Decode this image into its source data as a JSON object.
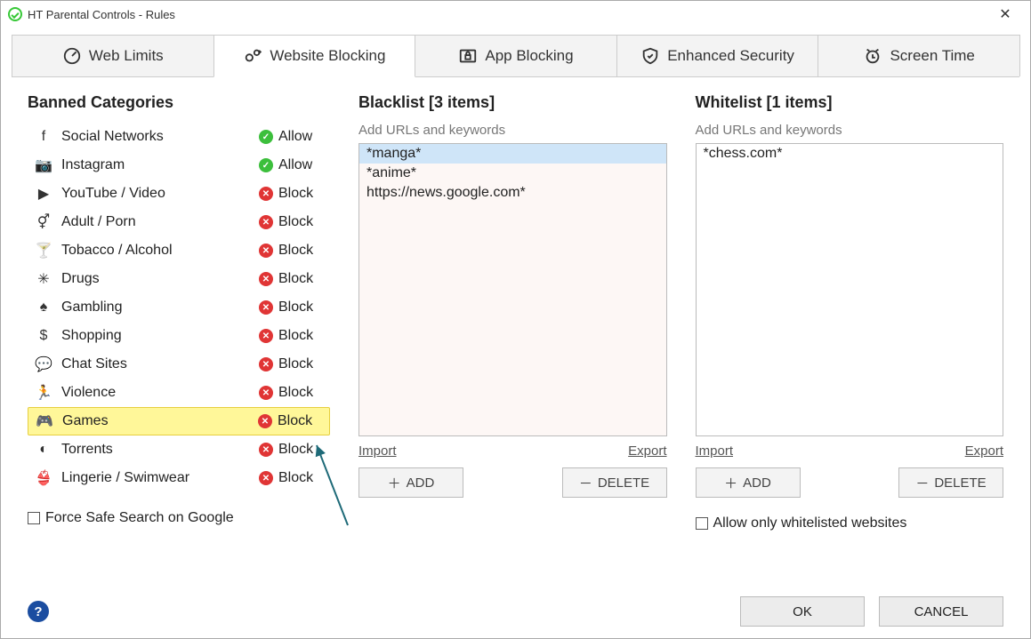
{
  "window": {
    "title": "HT Parental Controls - Rules"
  },
  "tabs": [
    {
      "label": "Web Limits"
    },
    {
      "label": "Website Blocking"
    },
    {
      "label": "App Blocking"
    },
    {
      "label": "Enhanced Security"
    },
    {
      "label": "Screen Time"
    }
  ],
  "categories": {
    "title": "Banned Categories",
    "items": [
      {
        "label": "Social Networks",
        "status": "Allow"
      },
      {
        "label": "Instagram",
        "status": "Allow"
      },
      {
        "label": "YouTube / Video",
        "status": "Block"
      },
      {
        "label": "Adult / Porn",
        "status": "Block"
      },
      {
        "label": "Tobacco / Alcohol",
        "status": "Block"
      },
      {
        "label": "Drugs",
        "status": "Block"
      },
      {
        "label": "Gambling",
        "status": "Block"
      },
      {
        "label": "Shopping",
        "status": "Block"
      },
      {
        "label": "Chat Sites",
        "status": "Block"
      },
      {
        "label": "Violence",
        "status": "Block"
      },
      {
        "label": "Games",
        "status": "Block",
        "highlight": true
      },
      {
        "label": "Torrents",
        "status": "Block"
      },
      {
        "label": "Lingerie / Swimwear",
        "status": "Block"
      }
    ],
    "safe_search_label": "Force Safe Search on Google"
  },
  "blacklist": {
    "title": "Blacklist [3 items]",
    "hint": "Add URLs and keywords",
    "items": [
      "*manga*",
      "*anime*",
      "https://news.google.com*"
    ],
    "import": "Import",
    "export": "Export",
    "add": "ADD",
    "delete": "DELETE"
  },
  "whitelist": {
    "title": "Whitelist [1 items]",
    "hint": "Add URLs and keywords",
    "items": [
      "*chess.com*"
    ],
    "import": "Import",
    "export": "Export",
    "add": "ADD",
    "delete": "DELETE",
    "only_whitelisted_label": "Allow only whitelisted websites"
  },
  "buttons": {
    "ok": "OK",
    "cancel": "CANCEL"
  }
}
